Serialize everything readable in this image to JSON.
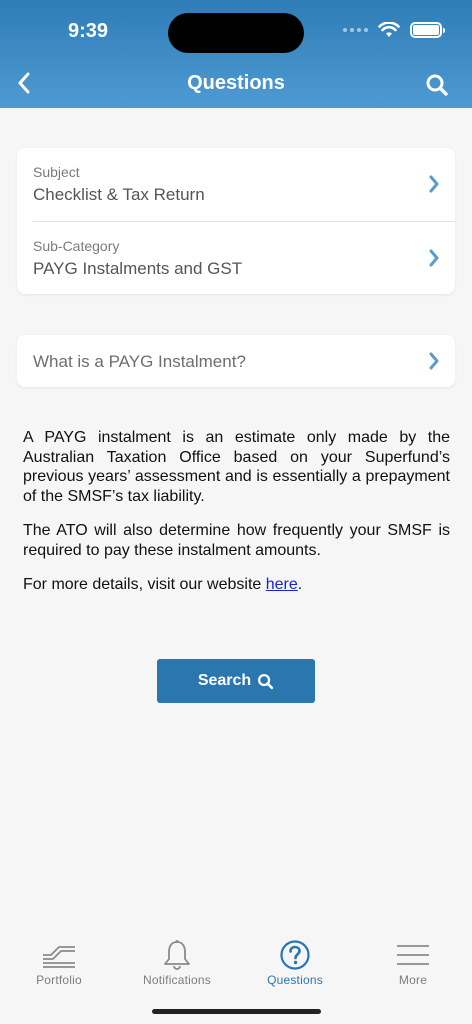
{
  "status": {
    "time": "9:39"
  },
  "header": {
    "title": "Questions"
  },
  "filters": [
    {
      "label": "Subject",
      "value": "Checklist & Tax Return"
    },
    {
      "label": "Sub-Category",
      "value": "PAYG Instalments and GST"
    }
  ],
  "question": {
    "value": "What is a PAYG Instalment?"
  },
  "answer": {
    "p1": "A PAYG instalment is an estimate only made by the Australian Taxation Office based on your Superfund’s previous years’ assessment and is essentially a prepayment of the SMSF’s tax liability.",
    "p2": "The ATO will also determine how frequently your SMSF is required to pay these instalment amounts.",
    "p3_prefix": "For more details, visit our website ",
    "p3_link": "here",
    "p3_suffix": "."
  },
  "search_button": {
    "label": "Search"
  },
  "tabs": [
    {
      "label": "Portfolio",
      "icon": "portfolio-chart-icon"
    },
    {
      "label": "Notifications",
      "icon": "bell-icon"
    },
    {
      "label": "Questions",
      "icon": "question-circle-icon",
      "active": true
    },
    {
      "label": "More",
      "icon": "hamburger-menu-icon"
    }
  ],
  "colors": {
    "header": "#3a8ac6",
    "accent": "#2a77b0",
    "chevron": "#5b9bcc",
    "link": "#1a25c9"
  }
}
